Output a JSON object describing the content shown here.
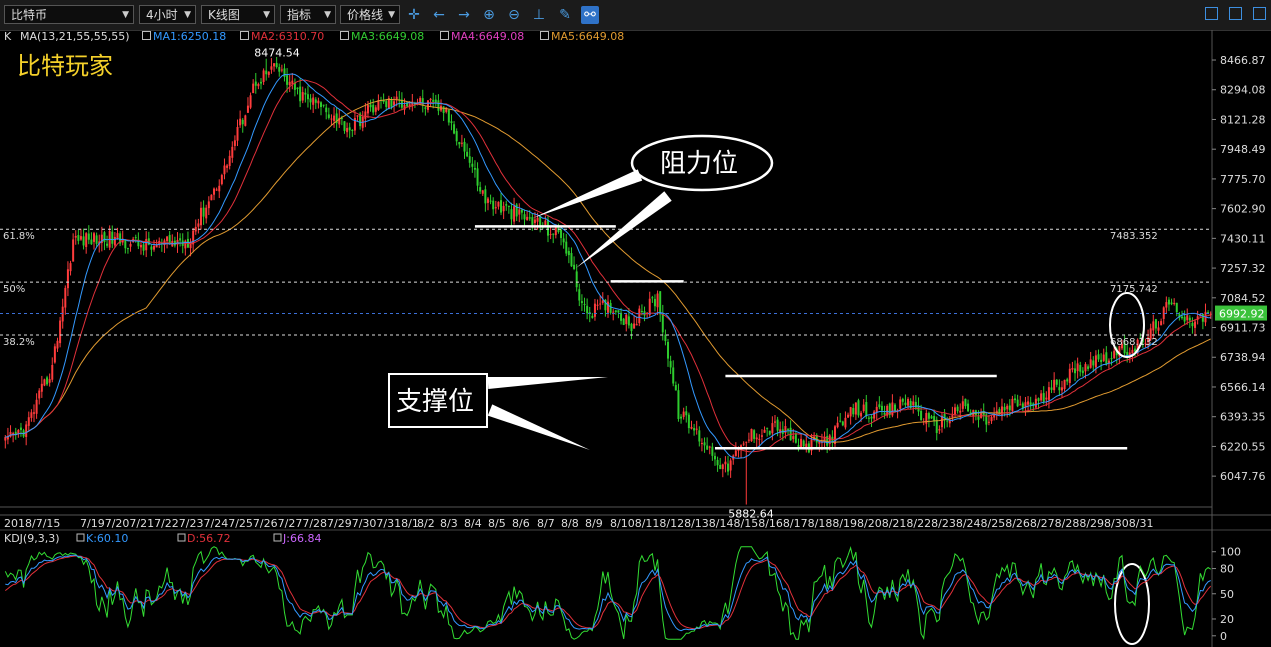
{
  "toolbar": {
    "symbol": "比特币",
    "period": "4小时",
    "chart_type": "K线图",
    "indicator": "指标",
    "price_line": "价格线"
  },
  "watermark": "比特玩家",
  "indicator_header": {
    "k": "K",
    "ma_params": "MA(13,21,55,55,55)",
    "ma1": "MA1:6250.18",
    "ma2": "MA2:6310.70",
    "ma3": "MA3:6649.08",
    "ma4": "MA4:6649.08",
    "ma5": "MA5:6649.08"
  },
  "kdj_header": {
    "params": "KDJ(9,3,3)",
    "k": "K:60.10",
    "d": "D:56.72",
    "j": "J:66.84"
  },
  "annotations": {
    "resistance": "阻力位",
    "support": "支撑位"
  },
  "colors": {
    "up": "#ff3c3c",
    "down": "#2ecc2e",
    "ma1": "#3399ff",
    "ma2": "#e0303a",
    "ma3": "#e09a30",
    "ma4": "#e040c0",
    "ma5": "#e09a30",
    "k_line": "#3399ff",
    "d_line": "#e0303a",
    "j_line": "#33dd33"
  },
  "chart_data": [
    {
      "type": "candlestick",
      "title": "",
      "y_ticks": [
        8466.87,
        8294.08,
        8121.28,
        7948.49,
        7775.7,
        7602.9,
        7430.11,
        7257.32,
        7084.52,
        6911.73,
        6738.94,
        6566.14,
        6393.35,
        6220.55,
        6047.76
      ],
      "ylim": [
        5880,
        8560
      ],
      "last_price": "6992.92",
      "high_label": "8474.54",
      "low_label": "5882.64",
      "fib_levels": [
        {
          "label": "61.8%",
          "value": 7483.352,
          "value_label": "7483.352"
        },
        {
          "label": "50%",
          "value": 7175.742,
          "value_label": "7175.742"
        },
        {
          "label": "38.2%",
          "value": 6868.132,
          "value_label": "6868.132"
        }
      ],
      "x_labels": [
        "2018/7/15",
        "7/19",
        "7/20",
        "7/21",
        "7/22",
        "7/23",
        "7/24",
        "7/25",
        "7/26",
        "7/27",
        "7/28",
        "7/29",
        "7/30",
        "7/31",
        "8/1",
        "8/2",
        "8/3",
        "8/4",
        "8/5",
        "8/6",
        "8/7",
        "8/8",
        "8/9",
        "8/10",
        "8/11",
        "8/12",
        "8/13",
        "8/14",
        "8/15",
        "8/16",
        "8/17",
        "8/18",
        "8/19",
        "8/20",
        "8/21",
        "8/22",
        "8/23",
        "8/24",
        "8/25",
        "8/26",
        "8/27",
        "8/28",
        "8/29",
        "8/30",
        "8/31"
      ],
      "x_label_strings": [
        "2018/7/15",
        "7/197/207/217/227/237/247/257/267/277/287/297/307/318/1",
        "8/2",
        "8/3",
        "8/4",
        "8/5",
        "8/6",
        "8/7",
        "8/8",
        "8/9",
        "8/108/118/128/138/148/158/168/178/188/198/208/218/228/238/248/258/268/278/288/298/308/31"
      ],
      "close_anchors": [
        [
          0,
          6240
        ],
        [
          8,
          6330
        ],
        [
          18,
          6680
        ],
        [
          26,
          7420
        ],
        [
          40,
          7430
        ],
        [
          56,
          7380
        ],
        [
          70,
          7420
        ],
        [
          84,
          7830
        ],
        [
          96,
          8350
        ],
        [
          104,
          8420
        ],
        [
          112,
          8270
        ],
        [
          122,
          8190
        ],
        [
          132,
          8070
        ],
        [
          142,
          8210
        ],
        [
          156,
          8230
        ],
        [
          168,
          8180
        ],
        [
          176,
          7950
        ],
        [
          184,
          7650
        ],
        [
          194,
          7580
        ],
        [
          204,
          7520
        ],
        [
          214,
          7430
        ],
        [
          222,
          7000
        ],
        [
          232,
          7040
        ],
        [
          240,
          6930
        ],
        [
          250,
          7090
        ],
        [
          258,
          6420
        ],
        [
          266,
          6280
        ],
        [
          276,
          6090
        ],
        [
          286,
          6290
        ],
        [
          296,
          6340
        ],
        [
          306,
          6210
        ],
        [
          316,
          6270
        ],
        [
          326,
          6440
        ],
        [
          336,
          6400
        ],
        [
          346,
          6490
        ],
        [
          356,
          6330
        ],
        [
          366,
          6450
        ],
        [
          376,
          6370
        ],
        [
          386,
          6460
        ],
        [
          396,
          6480
        ],
        [
          406,
          6620
        ],
        [
          416,
          6720
        ],
        [
          426,
          6760
        ],
        [
          436,
          6820
        ],
        [
          446,
          7040
        ],
        [
          456,
          6950
        ],
        [
          462,
          6992
        ]
      ],
      "ma1_close_anchors": "computed",
      "resistance_lines": [
        {
          "from_index": 180,
          "to_index": 234,
          "value": 7500
        },
        {
          "from_index": 232,
          "to_index": 260,
          "value": 7180
        }
      ],
      "support_lines": [
        {
          "from_index": 276,
          "to_index": 380,
          "value": 6630
        },
        {
          "from_index": 272,
          "to_index": 430,
          "value": 6210
        }
      ]
    },
    {
      "type": "line",
      "title": "",
      "y_ticks": [
        100,
        80,
        50,
        20,
        0
      ],
      "ylim": [
        -5,
        108
      ],
      "series": [
        {
          "name": "K",
          "last_value": 60.1
        },
        {
          "name": "D",
          "last_value": 56.72
        },
        {
          "name": "J",
          "last_value": 66.84
        }
      ]
    }
  ]
}
